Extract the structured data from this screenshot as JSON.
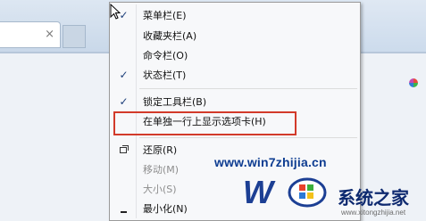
{
  "browser": {
    "tab_close_glyph": "×"
  },
  "context_menu": {
    "items": [
      {
        "label": "菜单栏(E)",
        "checked": true,
        "disabled": false
      },
      {
        "label": "收藏夹栏(A)",
        "checked": false,
        "disabled": false
      },
      {
        "label": "命令栏(O)",
        "checked": false,
        "disabled": false
      },
      {
        "label": "状态栏(T)",
        "checked": true,
        "disabled": false
      },
      {
        "label": "锁定工具栏(B)",
        "checked": true,
        "disabled": false
      },
      {
        "label": "在单独一行上显示选项卡(H)",
        "checked": false,
        "disabled": false,
        "highlighted": true
      },
      {
        "label": "还原(R)",
        "checked": false,
        "disabled": false,
        "icon": "restore-icon"
      },
      {
        "label": "移动(M)",
        "checked": false,
        "disabled": true
      },
      {
        "label": "大小(S)",
        "checked": false,
        "disabled": true
      },
      {
        "label": "最小化(N)",
        "checked": false,
        "disabled": false,
        "icon": "minimize-icon"
      }
    ],
    "check_glyph": "✓",
    "highlight_color": "#d23a2a"
  },
  "watermark": {
    "url": "www.win7zhijia.cn",
    "logo_text": "系统之家",
    "logo_sub": "www.xitongzhijia.net"
  }
}
